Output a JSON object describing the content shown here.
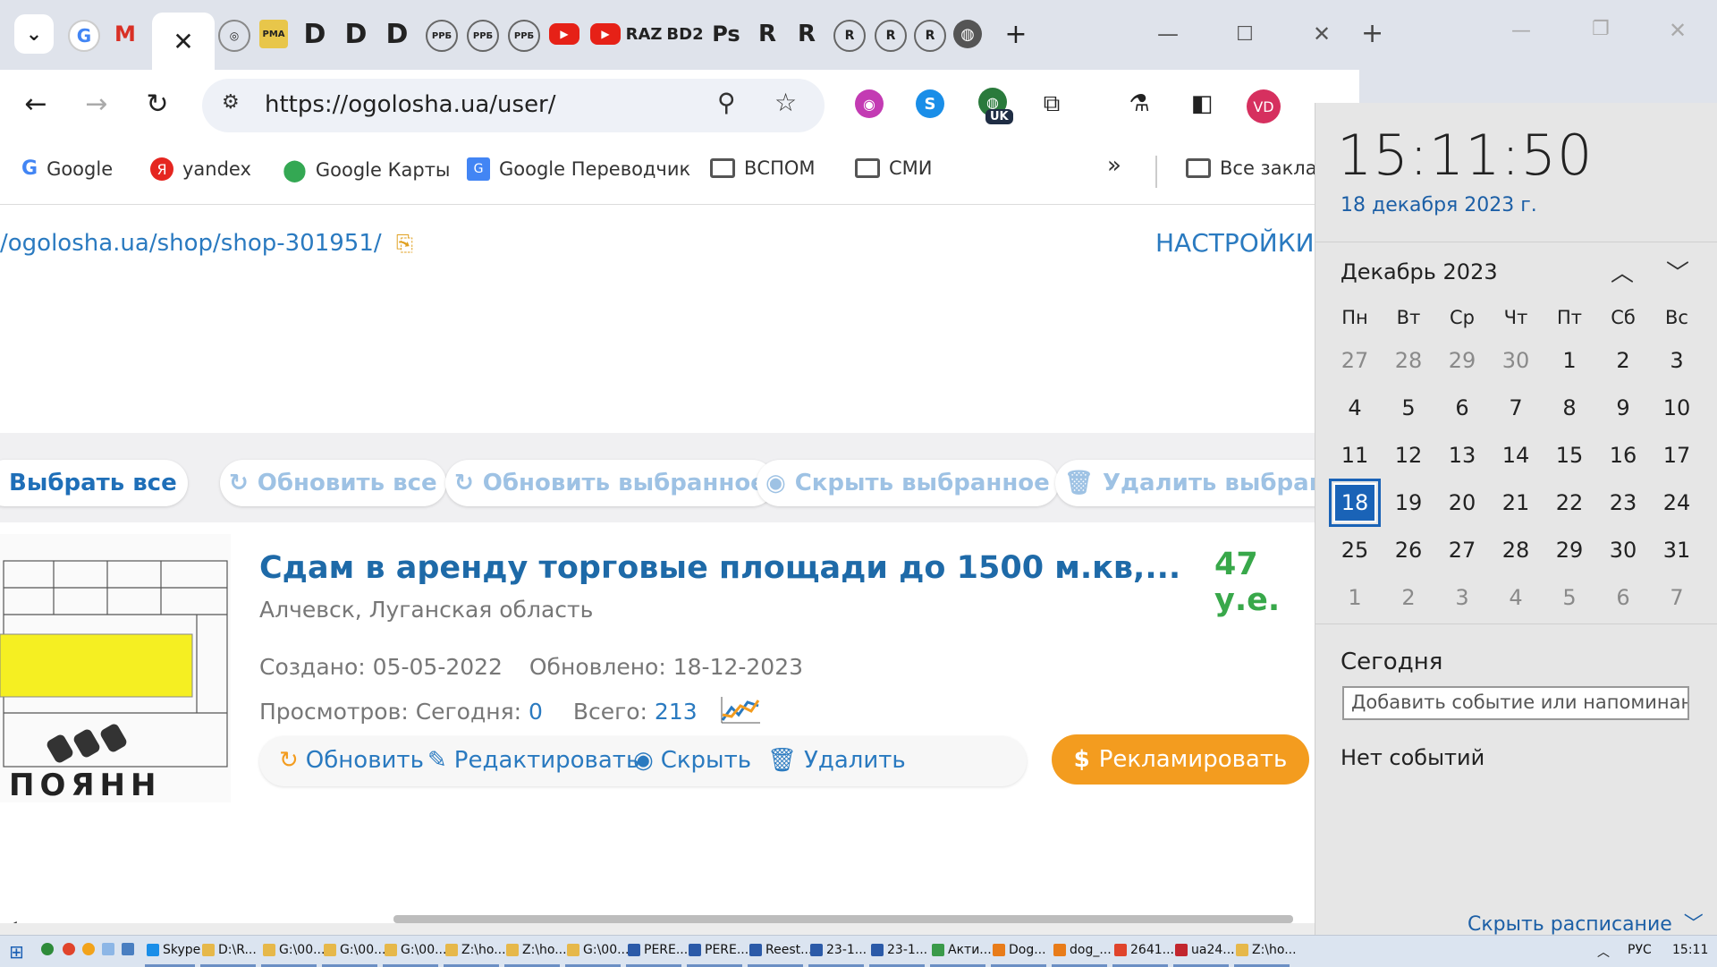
{
  "browser": {
    "active_tab_close": "✕",
    "new_tab": "+",
    "tab_labels": [
      "D",
      "D",
      "D",
      "RAZ",
      "BD2",
      "Ps",
      "R",
      "R"
    ],
    "url": "https://ogolosha.ua/user/",
    "profile_initials": "VD",
    "translate_badge": "UK"
  },
  "bookmarks": {
    "items": [
      "Google",
      "yandex",
      "Google Карты",
      "Google Переводчик",
      "ВСПОМ",
      "СМИ"
    ],
    "more": "»",
    "all_bookmarks": "Все заклад"
  },
  "page": {
    "shop_link": "/ogolosha.ua/shop/shop-301951/",
    "settings": "НАСТРОЙКИ",
    "bulk": {
      "select_all": "Выбрать все",
      "refresh_all": "Обновить все",
      "refresh_selected": "Обновить выбранное",
      "hide_selected": "Скрыть выбранное",
      "delete_selected": "Удалить выбранное"
    },
    "listing": {
      "title": "Сдам в аренду торговые площади до 1500 м.кв,...",
      "price": "47 у.е.",
      "location": "Алчевск, Луганская область",
      "created_label": "Создано:",
      "created": "05-05-2022",
      "updated_label": "Обновлено:",
      "updated": "18-12-2023",
      "views_label": "Просмотров:",
      "today_label": "Сегодня:",
      "today_count": "0",
      "total_label": "Всего:",
      "total_count": "213",
      "actions": {
        "refresh": "Обновить",
        "edit": "Редактировать",
        "hide": "Скрыть",
        "delete": "Удалить",
        "promote": "Рекламировать"
      }
    }
  },
  "clock": {
    "time": "15:11:50",
    "date": "18 декабря 2023 г.",
    "month": "Декабрь 2023",
    "weekdays": [
      "Пн",
      "Вт",
      "Ср",
      "Чт",
      "Пт",
      "Сб",
      "Вс"
    ],
    "days": [
      [
        "27",
        "28",
        "29",
        "30",
        "1",
        "2",
        "3"
      ],
      [
        "4",
        "5",
        "6",
        "7",
        "8",
        "9",
        "10"
      ],
      [
        "11",
        "12",
        "13",
        "14",
        "15",
        "16",
        "17"
      ],
      [
        "18",
        "19",
        "20",
        "21",
        "22",
        "23",
        "24"
      ],
      [
        "25",
        "26",
        "27",
        "28",
        "29",
        "30",
        "31"
      ],
      [
        "1",
        "2",
        "3",
        "4",
        "5",
        "6",
        "7"
      ]
    ],
    "today_value": "18",
    "today_heading": "Сегодня",
    "event_placeholder": "Добавить событие или напоминан",
    "no_events": "Нет событий",
    "hide_schedule": "Скрыть расписание"
  },
  "taskbar": {
    "items": [
      "Skype",
      "D:\\R...",
      "G:\\00...",
      "G:\\00...",
      "G:\\00...",
      "Z:\\ho...",
      "Z:\\ho...",
      "G:\\00...",
      "PERE...",
      "PERE...",
      "Reest...",
      "23-1...",
      "23-1...",
      "Акти...",
      "Dog...",
      "dog_...",
      "2641...",
      "ua24...",
      "Z:\\ho..."
    ],
    "lang": "РУС",
    "time": "15:11"
  }
}
